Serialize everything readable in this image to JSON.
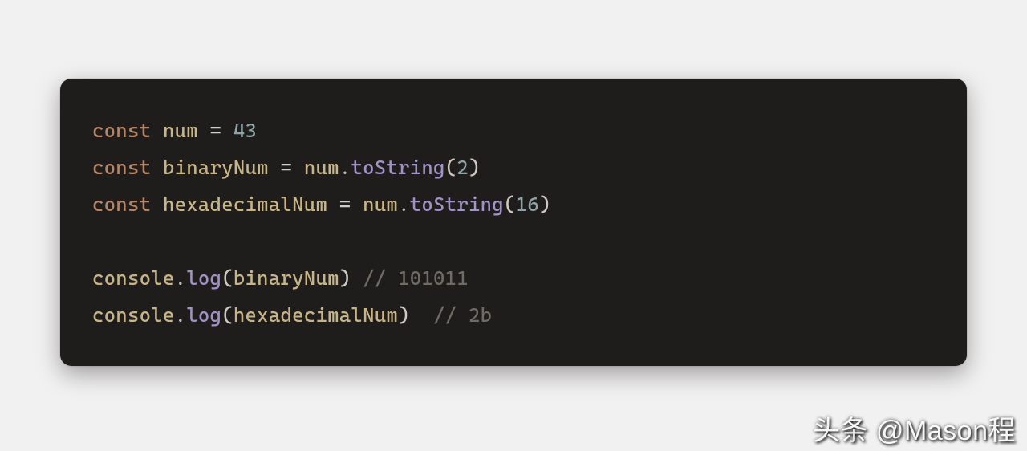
{
  "code": {
    "lines": [
      {
        "tokens": [
          {
            "cls": "kw",
            "t": "const "
          },
          {
            "cls": "ident",
            "t": "num"
          },
          {
            "cls": "op",
            "t": " = "
          },
          {
            "cls": "num",
            "t": "43"
          }
        ]
      },
      {
        "tokens": [
          {
            "cls": "kw",
            "t": "const "
          },
          {
            "cls": "ident",
            "t": "binaryNum"
          },
          {
            "cls": "op",
            "t": " = "
          },
          {
            "cls": "obj",
            "t": "num"
          },
          {
            "cls": "dot",
            "t": "."
          },
          {
            "cls": "fn",
            "t": "toString"
          },
          {
            "cls": "paren",
            "t": "("
          },
          {
            "cls": "num",
            "t": "2"
          },
          {
            "cls": "paren",
            "t": ")"
          }
        ]
      },
      {
        "tokens": [
          {
            "cls": "kw",
            "t": "const "
          },
          {
            "cls": "ident",
            "t": "hexadecimalNum"
          },
          {
            "cls": "op",
            "t": " = "
          },
          {
            "cls": "obj",
            "t": "num"
          },
          {
            "cls": "dot",
            "t": "."
          },
          {
            "cls": "fn",
            "t": "toString"
          },
          {
            "cls": "paren",
            "t": "("
          },
          {
            "cls": "num",
            "t": "16"
          },
          {
            "cls": "paren",
            "t": ")"
          }
        ]
      },
      {
        "tokens": []
      },
      {
        "tokens": [
          {
            "cls": "obj",
            "t": "console"
          },
          {
            "cls": "dot",
            "t": "."
          },
          {
            "cls": "fn",
            "t": "log"
          },
          {
            "cls": "paren",
            "t": "("
          },
          {
            "cls": "obj",
            "t": "binaryNum"
          },
          {
            "cls": "paren",
            "t": ")"
          },
          {
            "cls": "cmt",
            "t": " // 101011"
          }
        ]
      },
      {
        "tokens": [
          {
            "cls": "obj",
            "t": "console"
          },
          {
            "cls": "dot",
            "t": "."
          },
          {
            "cls": "fn",
            "t": "log"
          },
          {
            "cls": "paren",
            "t": "("
          },
          {
            "cls": "obj",
            "t": "hexadecimalNum"
          },
          {
            "cls": "paren",
            "t": ")"
          },
          {
            "cls": "cmt",
            "t": "  // 2b"
          }
        ]
      }
    ]
  },
  "watermark": "头条 @Mason程"
}
